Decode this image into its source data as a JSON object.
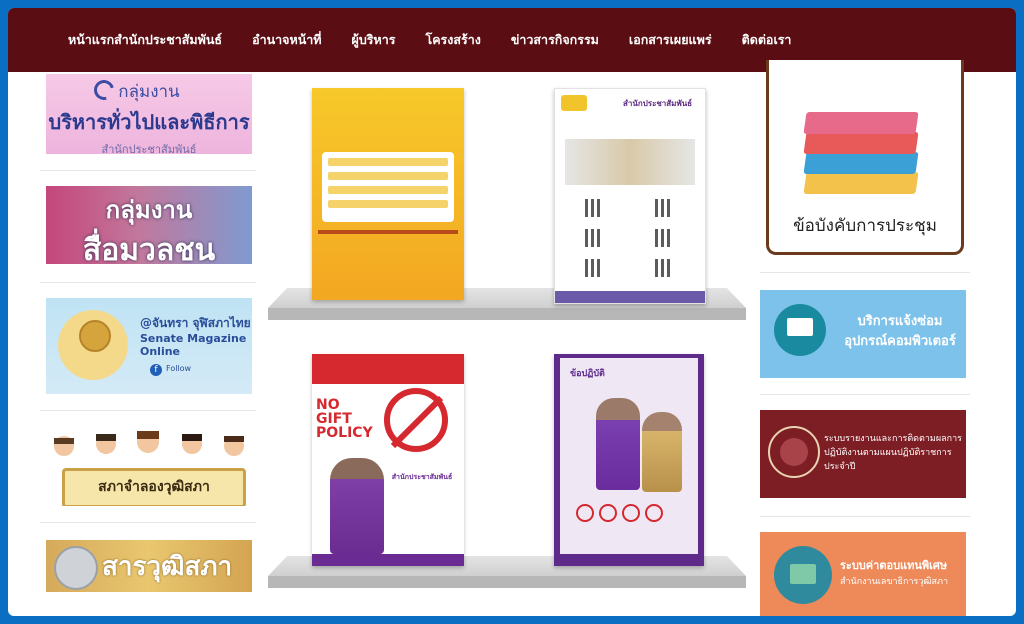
{
  "nav": {
    "items": [
      {
        "label": "หน้าแรกสำนักประชาสัมพันธ์"
      },
      {
        "label": "อำนาจหน้าที่"
      },
      {
        "label": "ผู้บริหาร"
      },
      {
        "label": "โครงสร้าง"
      },
      {
        "label": "ข่าวสารกิจกรรม"
      },
      {
        "label": "เอกสารเผยแพร่"
      },
      {
        "label": "ติดต่อเรา"
      }
    ]
  },
  "left_banners": {
    "admin": {
      "line1": "กลุ่มงาน",
      "line2": "บริหารทั่วไปและพิธีการ",
      "line3": "สำนักประชาสัมพันธ์"
    },
    "media": {
      "line1": "กลุ่มงาน",
      "line2": "สื่อมวลชน"
    },
    "magazine": {
      "line1": "@จันทรา จุฬิสภาไทย",
      "line2": "Senate Magazine Online",
      "fb": "Follow"
    },
    "youth": {
      "label": "สภาจำลองวุฒิสภา"
    },
    "journal": {
      "label": "สารวุฒิสภา"
    }
  },
  "posters": {
    "p2_title": "สำนักประชาสัมพันธ์",
    "p3_headline": "NO GIFT POLICY",
    "p3_text": "สำนักประชาสัมพันธ์",
    "p4_title": "ข้อปฏิบัติ"
  },
  "right": {
    "meeting_label": "ข้อบังคับการประชุม",
    "repair": "บริการแจ้งซ่อมอุปกรณ์คอมพิวเตอร์",
    "report": "ระบบรายงานและการติดตามผลการปฏิบัติงานตามแผนปฏิบัติราชการประจำปี",
    "allowance_title": "ระบบค่าตอบแทนพิเศษ",
    "allowance_sub": "สำนักงานเลขาธิการวุฒิสภา"
  },
  "colors": {
    "nav_bg": "#5a0e14",
    "frame_border": "#0a6fc2"
  }
}
